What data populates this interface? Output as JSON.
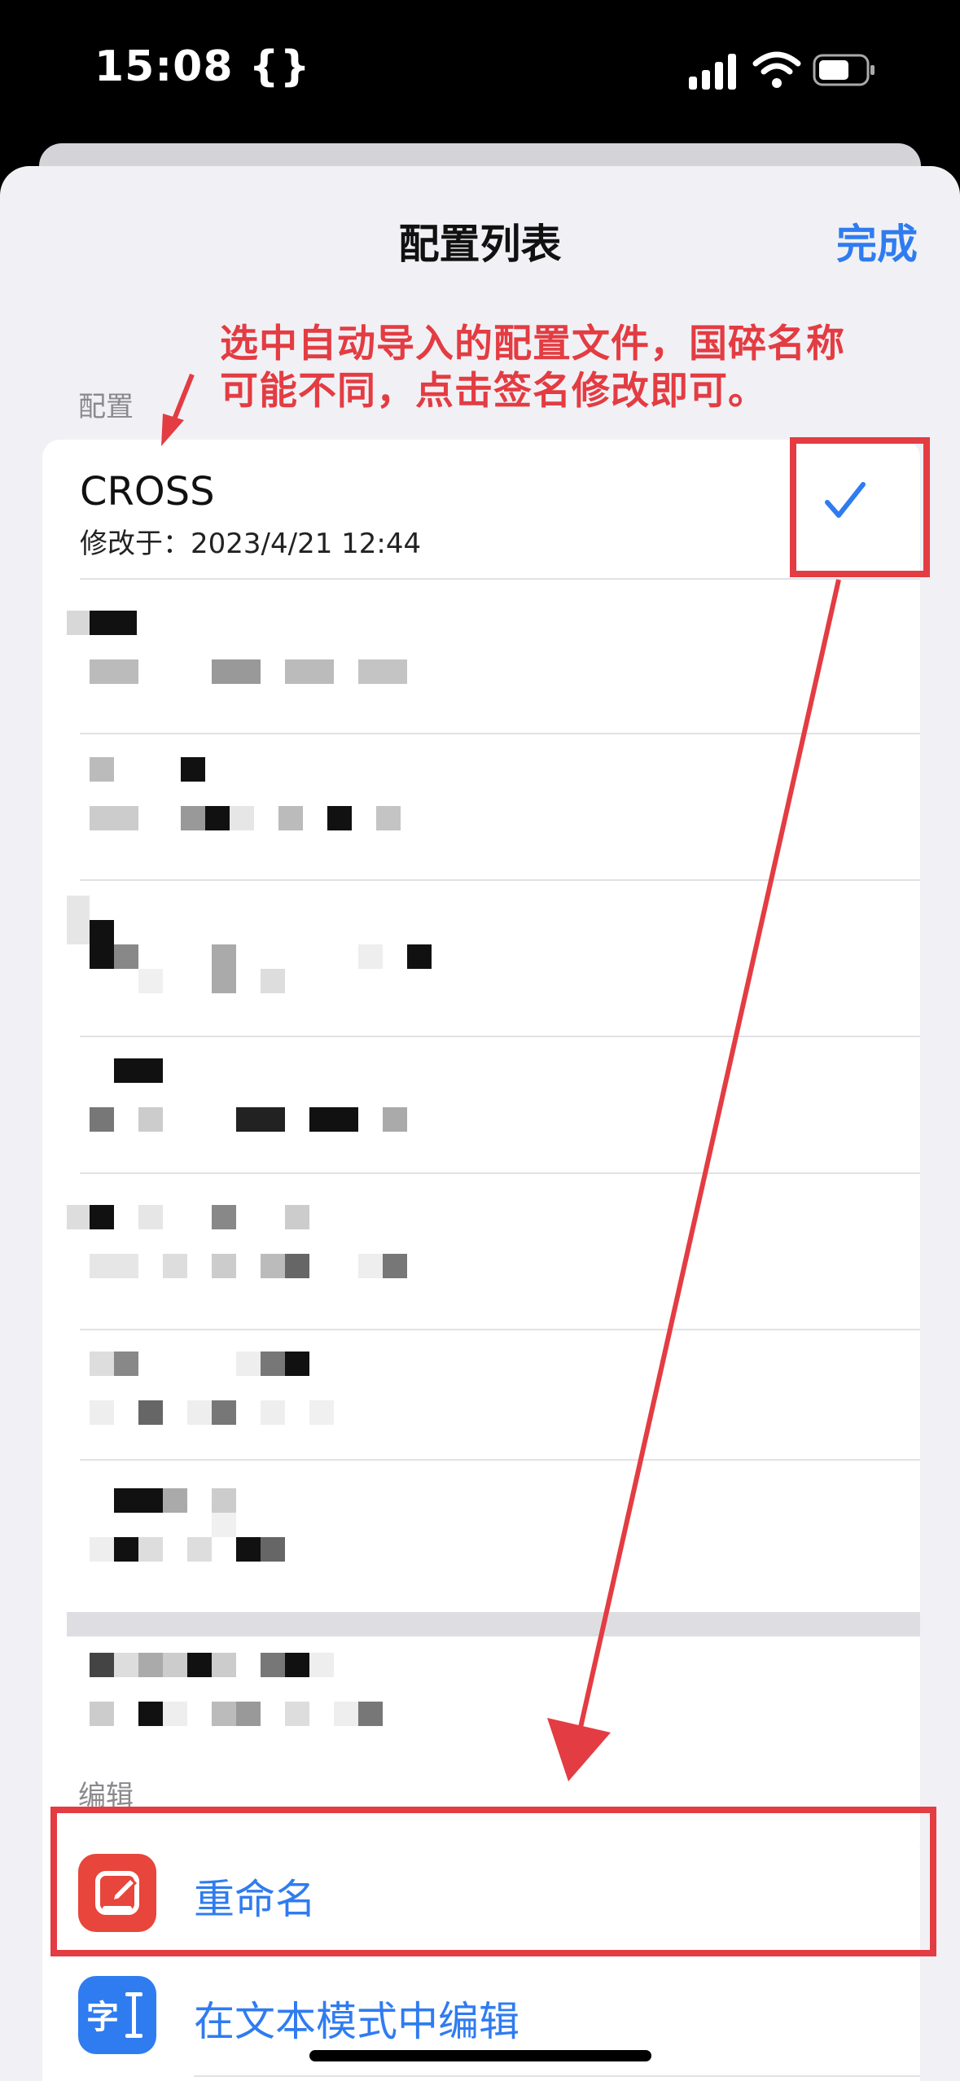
{
  "status_bar": {
    "time": "15:08 {}"
  },
  "nav": {
    "title": "配置列表",
    "done_label": "完成"
  },
  "sections": {
    "config_header": "配置",
    "edit_header": "编辑"
  },
  "annotation": {
    "line1": "选中自动导入的配置文件，国碎名称",
    "line2": "可能不同，点击签名修改即可。"
  },
  "selected_config": {
    "name": "CROSS",
    "modified": "修改于：2023/4/21 12:44",
    "checked": true
  },
  "edit_menu": {
    "items": [
      {
        "label": "重命名",
        "icon": "pencil-icon",
        "color": "#e8453c"
      },
      {
        "label": "在文本模式中编辑",
        "icon": "text-cursor-icon",
        "color": "#2f7cf0"
      }
    ]
  },
  "colors": {
    "accent": "#2f7cf0",
    "annotation_red": "#e33c42"
  }
}
